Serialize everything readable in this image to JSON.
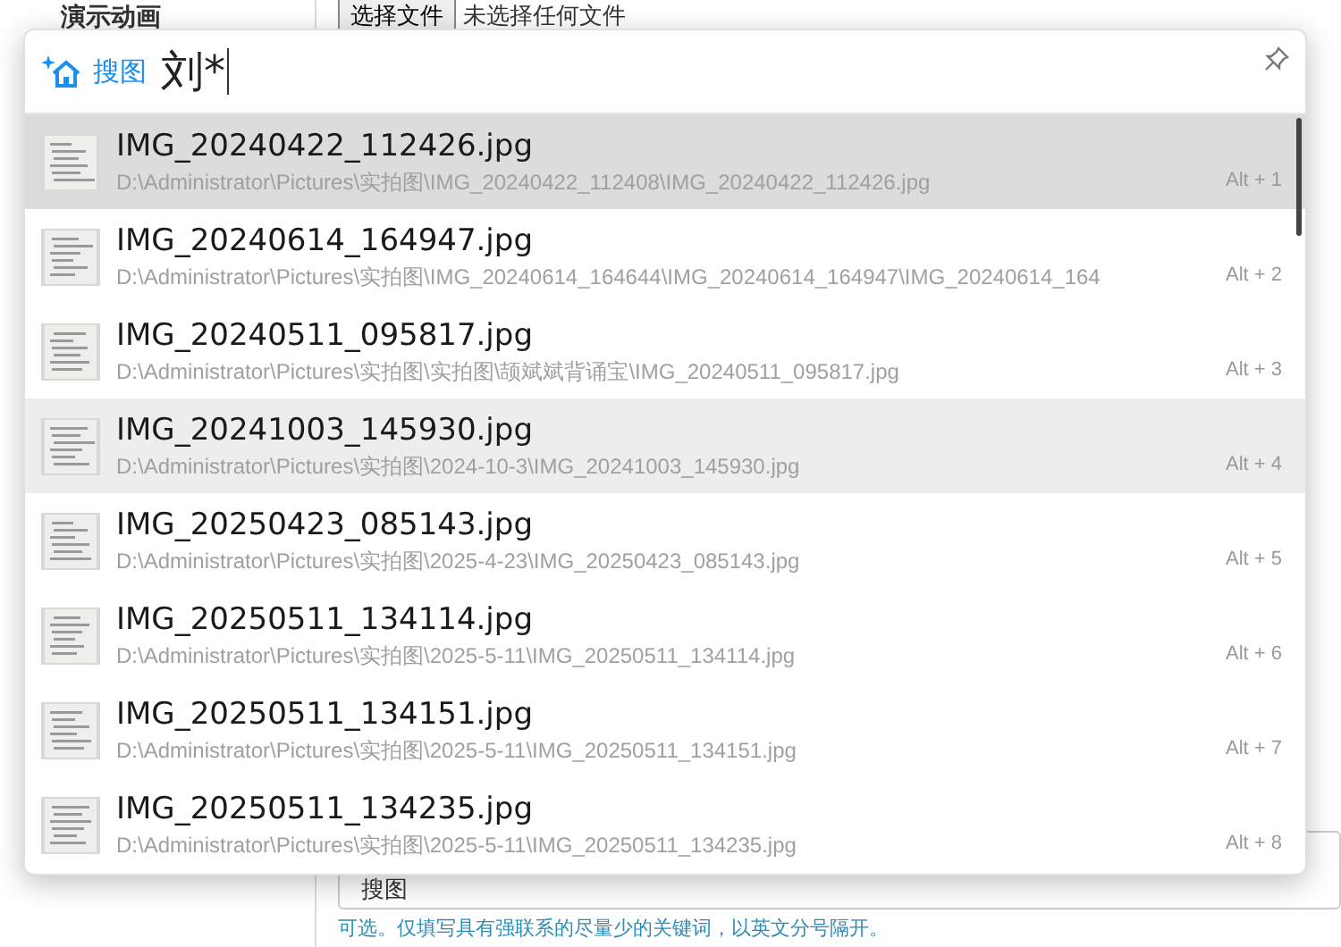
{
  "page": {
    "section_label": "演示动画",
    "file_button": "选择文件",
    "file_status": "未选择任何文件",
    "keyword_field_value": "搜图",
    "keyword_hint": "可选。仅填写具有强联系的尽量少的关键词，以英文分号隔开。"
  },
  "popup": {
    "brand": "搜图",
    "query": "刘*",
    "pinned": false,
    "results": [
      {
        "name": "IMG_20240422_112426.jpg",
        "path": "D:\\Administrator\\Pictures\\实拍图\\IMG_20240422_112408\\IMG_20240422_112426.jpg",
        "shortcut": "Alt + 1",
        "selected": true,
        "hovered": false
      },
      {
        "name": "IMG_20240614_164947.jpg",
        "path": "D:\\Administrator\\Pictures\\实拍图\\IMG_20240614_164644\\IMG_20240614_164947\\IMG_20240614_164",
        "shortcut": "Alt + 2",
        "selected": false,
        "hovered": false
      },
      {
        "name": "IMG_20240511_095817.jpg",
        "path": "D:\\Administrator\\Pictures\\实拍图\\实拍图\\颉斌斌背诵宝\\IMG_20240511_095817.jpg",
        "shortcut": "Alt + 3",
        "selected": false,
        "hovered": false
      },
      {
        "name": "IMG_20241003_145930.jpg",
        "path": "D:\\Administrator\\Pictures\\实拍图\\2024-10-3\\IMG_20241003_145930.jpg",
        "shortcut": "Alt + 4",
        "selected": false,
        "hovered": true
      },
      {
        "name": "IMG_20250423_085143.jpg",
        "path": "D:\\Administrator\\Pictures\\实拍图\\2025-4-23\\IMG_20250423_085143.jpg",
        "shortcut": "Alt + 5",
        "selected": false,
        "hovered": false
      },
      {
        "name": "IMG_20250511_134114.jpg",
        "path": "D:\\Administrator\\Pictures\\实拍图\\2025-5-11\\IMG_20250511_134114.jpg",
        "shortcut": "Alt + 6",
        "selected": false,
        "hovered": false
      },
      {
        "name": "IMG_20250511_134151.jpg",
        "path": "D:\\Administrator\\Pictures\\实拍图\\2025-5-11\\IMG_20250511_134151.jpg",
        "shortcut": "Alt + 7",
        "selected": false,
        "hovered": false
      },
      {
        "name": "IMG_20250511_134235.jpg",
        "path": "D:\\Administrator\\Pictures\\实拍图\\2025-5-11\\IMG_20250511_134235.jpg",
        "shortcut": "Alt + 8",
        "selected": false,
        "hovered": false
      }
    ]
  }
}
